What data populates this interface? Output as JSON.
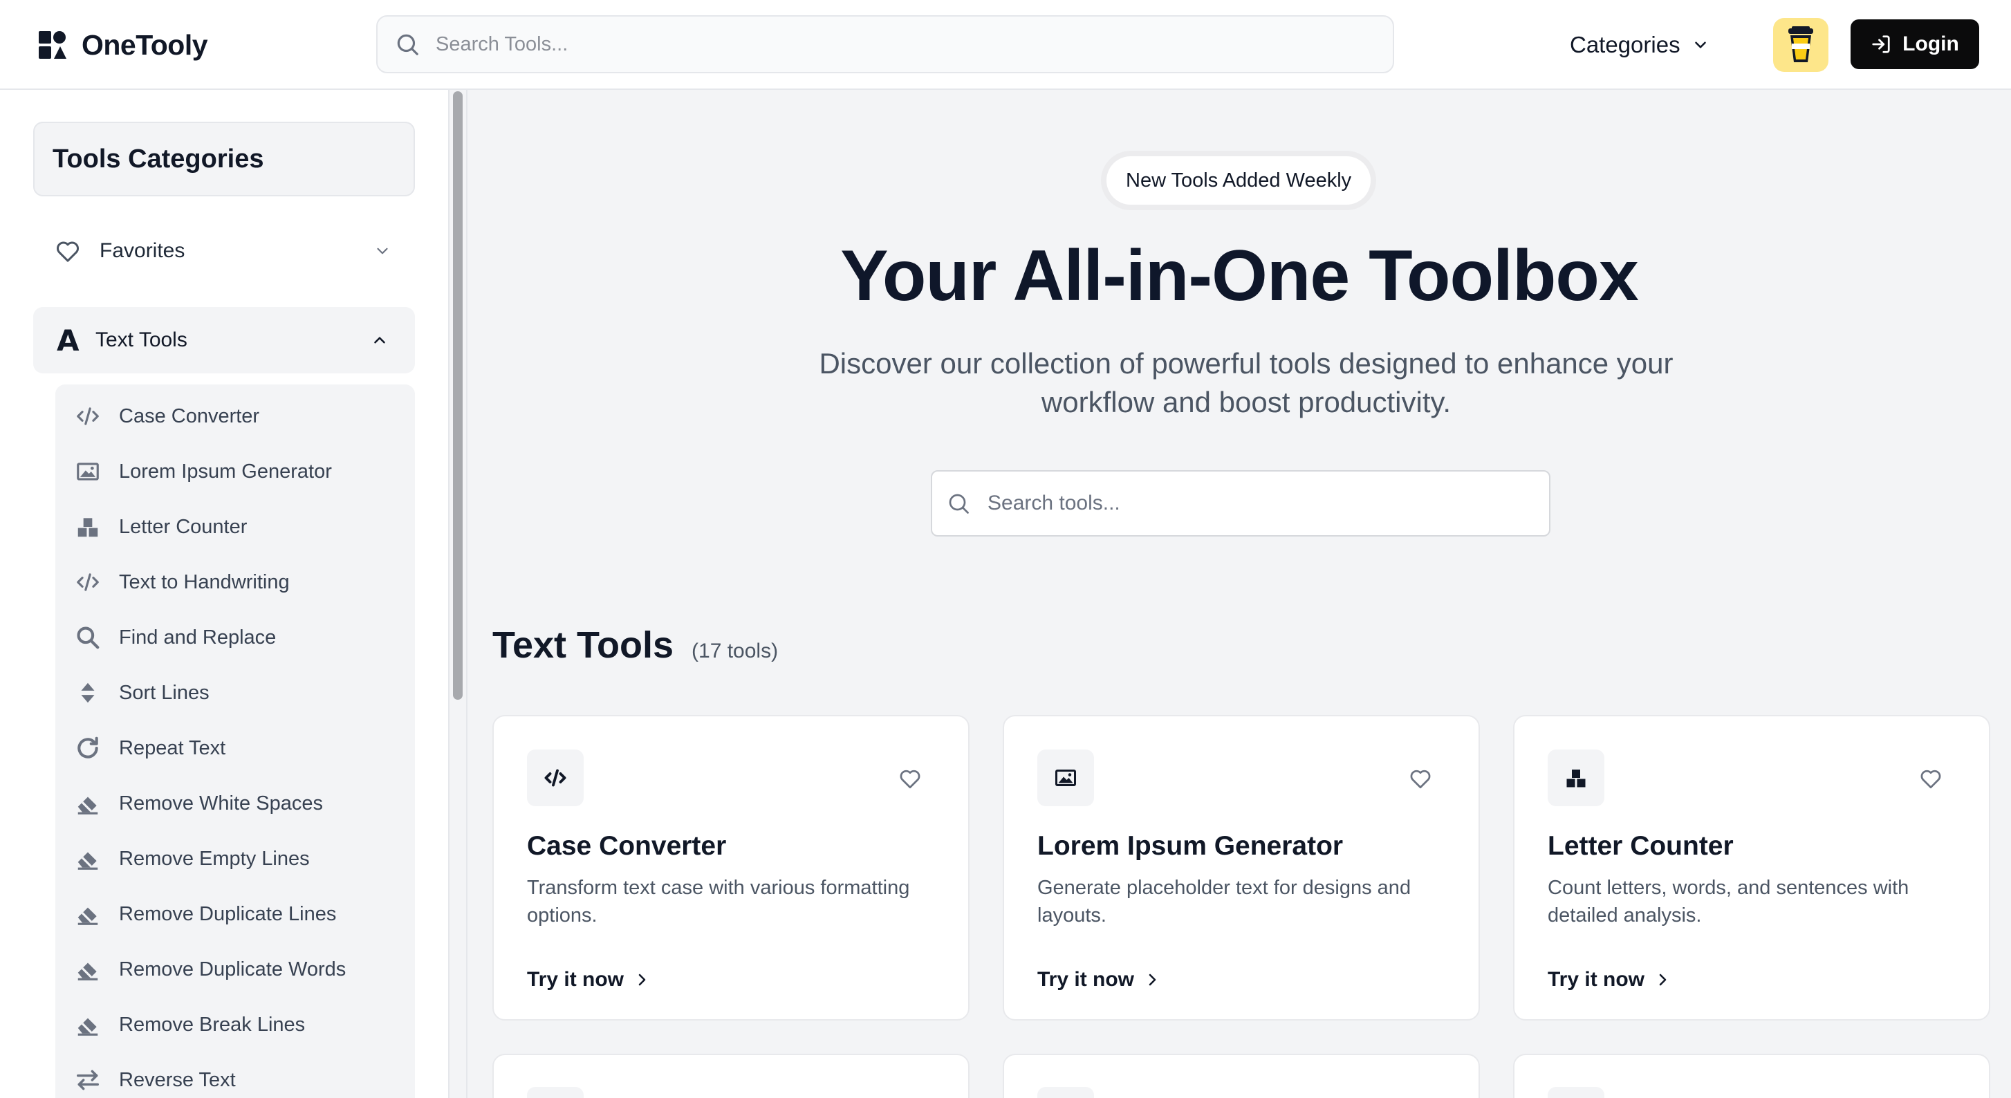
{
  "header": {
    "brand": "OneTooly",
    "search_placeholder": "Search Tools...",
    "categories_label": "Categories",
    "login_label": "Login"
  },
  "sidebar": {
    "title": "Tools Categories",
    "favorites_label": "Favorites",
    "active_category": "Text Tools",
    "items": [
      {
        "label": "Case Converter",
        "icon": "code-icon"
      },
      {
        "label": "Lorem Ipsum Generator",
        "icon": "image-icon"
      },
      {
        "label": "Letter Counter",
        "icon": "blocks-icon"
      },
      {
        "label": "Text to Handwriting",
        "icon": "code-icon"
      },
      {
        "label": "Find and Replace",
        "icon": "search-icon"
      },
      {
        "label": "Sort Lines",
        "icon": "sort-icon"
      },
      {
        "label": "Repeat Text",
        "icon": "repeat-icon"
      },
      {
        "label": "Remove White Spaces",
        "icon": "eraser-icon"
      },
      {
        "label": "Remove Empty Lines",
        "icon": "eraser-icon"
      },
      {
        "label": "Remove Duplicate Lines",
        "icon": "eraser-icon"
      },
      {
        "label": "Remove Duplicate Words",
        "icon": "eraser-icon"
      },
      {
        "label": "Remove Break Lines",
        "icon": "eraser-icon"
      },
      {
        "label": "Reverse Text",
        "icon": "swap-icon"
      }
    ]
  },
  "hero": {
    "badge": "New Tools Added Weekly",
    "title": "Your All-in-One Toolbox",
    "description": "Discover our collection of powerful tools designed to enhance your workflow and boost productivity.",
    "search_placeholder": "Search tools..."
  },
  "section": {
    "title": "Text Tools",
    "count": "(17 tools)"
  },
  "cards": [
    {
      "title": "Case Converter",
      "description": "Transform text case with various formatting options.",
      "cta": "Try it now",
      "icon": "code-icon"
    },
    {
      "title": "Lorem Ipsum Generator",
      "description": "Generate placeholder text for designs and layouts.",
      "cta": "Try it now",
      "icon": "image-icon"
    },
    {
      "title": "Letter Counter",
      "description": "Count letters, words, and sentences with detailed analysis.",
      "cta": "Try it now",
      "icon": "blocks-icon"
    }
  ],
  "colors": {
    "accent_dark": "#0b0b0c",
    "coffee_bg": "#fde68a",
    "panel_bg": "#f3f4f6",
    "text_primary": "#111827",
    "text_muted": "#4b5563"
  }
}
